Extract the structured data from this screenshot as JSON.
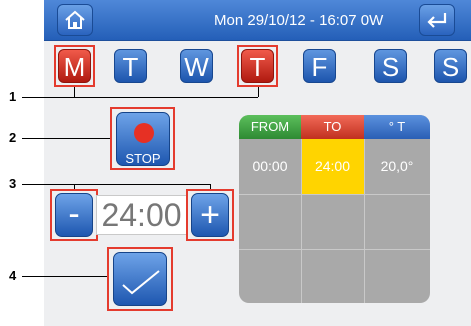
{
  "header": {
    "status": "Mon 29/10/12 - 16:07   0W",
    "home_icon": "home-icon",
    "back_icon": "return-arrow-icon"
  },
  "days": [
    {
      "label": "M",
      "state": "selected"
    },
    {
      "label": "T",
      "state": "normal"
    },
    {
      "label": "W",
      "state": "normal"
    },
    {
      "label": "T",
      "state": "selected"
    },
    {
      "label": "F",
      "state": "normal"
    },
    {
      "label": "S",
      "state": "normal"
    },
    {
      "label": "S",
      "state": "normal"
    }
  ],
  "callouts": [
    "1",
    "2",
    "3",
    "4"
  ],
  "stop_button": {
    "label": "STOP"
  },
  "time_adjust": {
    "value": "24:00",
    "minus": "-",
    "plus": "+"
  },
  "confirm_button": {
    "icon": "checkmark-icon"
  },
  "table": {
    "headers": [
      "FROM",
      "TO",
      "° T"
    ],
    "header_colors": [
      "#3ea043",
      "#e2523f",
      "#3c75c8"
    ],
    "rows": [
      [
        "00:00",
        "24:00",
        "20,0°"
      ],
      [
        "",
        "",
        ""
      ],
      [
        "",
        "",
        ""
      ]
    ]
  },
  "colors": {
    "accent_blue": "#245fb8",
    "selected_red": "#c8261b",
    "highlight_yellow": "#ffd400",
    "callout_box": "#e43b2e"
  }
}
